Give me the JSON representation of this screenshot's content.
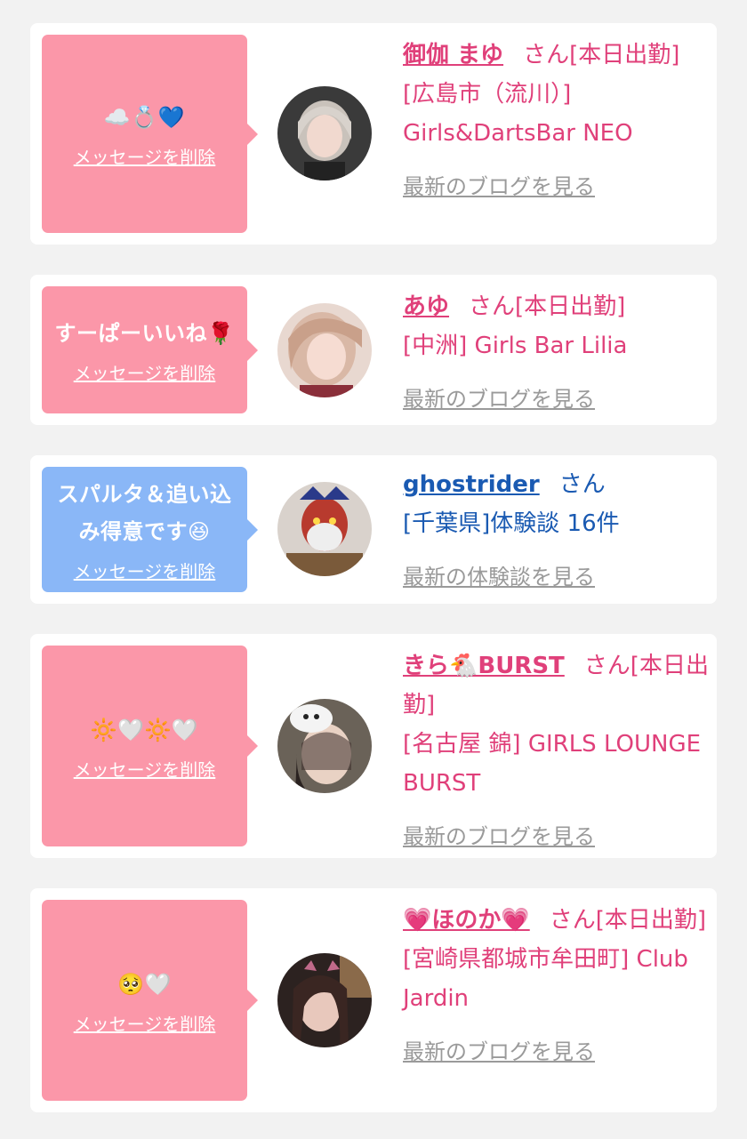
{
  "items": [
    {
      "message": "☁️💍💙",
      "delete_label": "メッセージを削除",
      "name": "御伽 まゆ",
      "honorific": "さん[本日出勤]",
      "shop": "[広島市（流川）] Girls&DartsBar NEO",
      "more_link": "最新のブログを見る",
      "bubble_color": "#fb97a9",
      "text_color": "#e0407a"
    },
    {
      "message": "すーぱーいいね🌹",
      "delete_label": "メッセージを削除",
      "name": "あゆ",
      "honorific": "さん[本日出勤]",
      "shop": "[中洲] Girls Bar Lilia",
      "more_link": "最新のブログを見る",
      "bubble_color": "#fb97a9",
      "text_color": "#e0407a"
    },
    {
      "message": "スパルタ＆追い込み得意です😆",
      "delete_label": "メッセージを削除",
      "name": "ghostrider",
      "honorific": "さん",
      "shop": "[千葉県]体験談 16件",
      "more_link": "最新の体験談を見る",
      "bubble_color": "#8ab7f7",
      "text_color": "#1a5ab2"
    },
    {
      "message": "🔆🤍🔆🤍",
      "delete_label": "メッセージを削除",
      "name": "きら🐔BURST",
      "honorific": "さん[本日出勤]",
      "shop": "[名古屋 錦] GIRLS LOUNGE BURST",
      "more_link": "最新のブログを見る",
      "bubble_color": "#fb97a9",
      "text_color": "#e0407a"
    },
    {
      "message": "🥺🤍",
      "delete_label": "メッセージを削除",
      "name": "💗ほのか💗",
      "honorific": "さん[本日出勤]",
      "shop": "[宮崎県都城市牟田町] Club Jardin",
      "more_link": "最新のブログを見る",
      "bubble_color": "#fb97a9",
      "text_color": "#e0407a"
    }
  ]
}
